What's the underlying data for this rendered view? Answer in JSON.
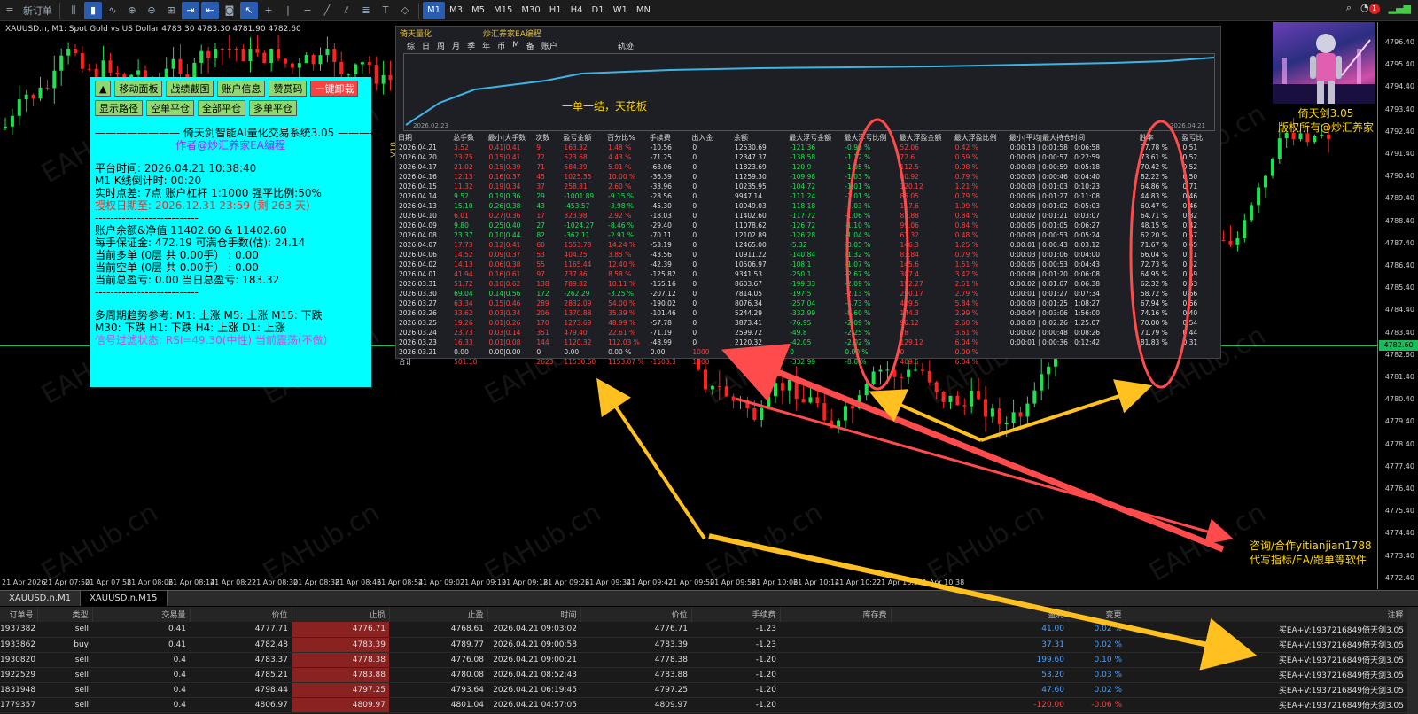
{
  "toolbar": {
    "new_order": "新订单",
    "timeframes": [
      "M1",
      "M3",
      "M5",
      "M15",
      "M30",
      "H1",
      "H4",
      "D1",
      "W1",
      "MN"
    ],
    "active_tf": "M1",
    "notif_count": "1"
  },
  "chart": {
    "title": "XAUUSD.n, M1:  Spot Gold vs US Dollar  4783.30 4783.30 4781.90 4782.60",
    "current_price": "4782.60",
    "version": "V18",
    "watermark": "EAHub.cn",
    "price_labels": [
      "4796.40",
      "4795.40",
      "4794.40",
      "4793.40",
      "4792.40",
      "4791.40",
      "4790.40",
      "4789.40",
      "4788.40",
      "4787.40",
      "4786.40",
      "4785.40",
      "4784.40",
      "4783.40",
      "4782.60",
      "4781.40",
      "4780.40",
      "4779.40",
      "4778.40",
      "4777.40",
      "4776.40",
      "4775.40",
      "4774.40",
      "4773.40",
      "4772.40"
    ],
    "time_labels": [
      "21 Apr 2026",
      "21 Apr 07:50",
      "21 Apr 07:58",
      "21 Apr 08:06",
      "21 Apr 08:14",
      "21 Apr 08:22",
      "21 Apr 08:30",
      "21 Apr 08:38",
      "21 Apr 08:46",
      "21 Apr 08:54",
      "21 Apr 09:02",
      "21 Apr 09:10",
      "21 Apr 09:18",
      "21 Apr 09:26",
      "21 Apr 09:34",
      "21 Apr 09:42",
      "21 Apr 09:50",
      "21 Apr 09:58",
      "21 Apr 10:06",
      "21 Apr 10:14",
      "21 Apr 10:22",
      "21 Apr 10:30",
      "21 Apr 10:38"
    ]
  },
  "left_panel": {
    "buttons_row1": [
      "▲",
      "移动面板",
      "战绩截图",
      "账户信息",
      "赞赏码",
      "一键卸载"
    ],
    "buttons_row2": [
      "显示路径",
      "空单平仓",
      "全部平仓",
      "多单平仓"
    ],
    "title": "———————— 倚天剑智能AI量化交易系统3.05 ————",
    "author": "作者@炒汇养家EA编程",
    "platform_time": "平台时间: 2026.04.21 10:38:40",
    "countdown": "       M1  K线倒计时:      00:20",
    "spread": "实时点差:  7点     账户杠杆 1:1000     强平比例:50%",
    "license": "授权日期至: 2026.12.31 23:59 (剩 263 天)",
    "divider": "   ---------------------------",
    "balance": "账户余额&净值 11402.60    &   11402.60",
    "margin": "每手保证金: 472.19      可满仓手数(估): 24.14",
    "buy_orders": "当前多单 (0层 共 0.00手） :  0.00",
    "sell_orders": "当前空单 (0层 共 0.00手） :  0.00",
    "total_pl": "当前总盈亏: 0.00      当日总盈亏: 183.32",
    "trend_label": "多周期趋势参考:    M1: 上涨    M5: 上涨    M15: 下跌",
    "trend_line2": "          M30: 下跌    H1: 下跌    H4: 上涨    D1: 上涨",
    "filter": "信号过滤状态: RSI=49.30(中性)      当前震荡(不做)"
  },
  "stats": {
    "header_left": "倚天量化",
    "header_mid": "炒汇养家EA编程",
    "tabs": [
      "综",
      "日",
      "周",
      "月",
      "季",
      "年",
      "币",
      "M",
      "备",
      "账户",
      "",
      "轨迹"
    ],
    "equity_text": "一单一结，天花板",
    "start_date": "2026.02.23",
    "end_date": "2026.04.21",
    "columns": [
      "日期",
      "总手数",
      "最小|大手数",
      "次数",
      "盈亏金额",
      "百分比%",
      "手续费",
      "出入金",
      "余额",
      "最大浮亏金额",
      "最大浮亏比例",
      "最大浮盈金额",
      "最大浮盈比例",
      "最小|平均|最大持仓时间",
      "",
      "胜率",
      "盈亏比"
    ],
    "rows": [
      [
        "2026.04.21",
        "3.52",
        "0.41|0.41",
        "9",
        "163.32",
        "1.48 %",
        "-10.56",
        "0",
        "12530.69",
        "-121.36",
        "-0.98 %",
        "52.06",
        "0.42 %",
        "0:00:13 | 0:01:58 | 0:06:58",
        "",
        "77.78 %",
        "0.51"
      ],
      [
        "2026.04.20",
        "23.75",
        "0.15|0.41",
        "72",
        "523.68",
        "4.43 %",
        "-71.25",
        "0",
        "12347.37",
        "-138.58",
        "-1.12 %",
        "72.6",
        "0.59 %",
        "0:00:03 | 0:00:57 | 0:22:59",
        "",
        "73.61 %",
        "0.52"
      ],
      [
        "2026.04.17",
        "21.02",
        "0.15|0.39",
        "71",
        "584.39",
        "5.01 %",
        "-63.06",
        "0",
        "11823.69",
        "-120.9",
        "-1.05 %",
        "112.5",
        "0.98 %",
        "0:00:03 | 0:00:59 | 0:05:18",
        "",
        "70.42 %",
        "0.52"
      ],
      [
        "2026.04.16",
        "12.13",
        "0.16|0.37",
        "45",
        "1025.35",
        "10.00 %",
        "-36.39",
        "0",
        "11259.30",
        "-109.98",
        "-1.03 %",
        "80.92",
        "0.79 %",
        "0:00:03 | 0:00:46 | 0:04:40",
        "",
        "82.22 %",
        "0.50"
      ],
      [
        "2026.04.15",
        "11.32",
        "0.19|0.34",
        "37",
        "258.81",
        "2.60 %",
        "-33.96",
        "0",
        "10235.95",
        "-104.72",
        "-1.01 %",
        "120.12",
        "1.21 %",
        "0:00:03 | 0:01:03 | 0:10:23",
        "",
        "64.86 %",
        "0.71"
      ],
      [
        "2026.04.14",
        "9.52",
        "0.19|0.36",
        "29",
        "-1001.89",
        "-9.15 %",
        "-28.56",
        "0",
        "9947.14",
        "-111.24",
        "-1.01 %",
        "85.05",
        "0.79 %",
        "0:00:06 | 0:01:27 | 0:11:08",
        "",
        "44.83 %",
        "0.46"
      ],
      [
        "2026.04.13",
        "15.10",
        "0.26|0.38",
        "43",
        "-453.57",
        "-3.98 %",
        "-45.30",
        "0",
        "10949.03",
        "-118.18",
        "-1.03 %",
        "117.6",
        "1.09 %",
        "0:00:03 | 0:01:02 | 0:05:03",
        "",
        "60.47 %",
        "0.46"
      ],
      [
        "2026.04.10",
        "6.01",
        "0.27|0.36",
        "17",
        "323.98",
        "2.92 %",
        "-18.03",
        "0",
        "11402.60",
        "-117.72",
        "-1.06 %",
        "82.88",
        "0.84 %",
        "0:00:02 | 0:01:21 | 0:03:07",
        "",
        "64.71 %",
        "0.82"
      ],
      [
        "2026.04.09",
        "9.80",
        "0.25|0.40",
        "27",
        "-1024.27",
        "-8.46 %",
        "-29.40",
        "0",
        "11078.62",
        "-126.72",
        "-1.10 %",
        "99.06",
        "0.84 %",
        "0:00:05 | 0:01:05 | 0:06:27",
        "",
        "48.15 %",
        "0.42"
      ],
      [
        "2026.04.08",
        "23.37",
        "0.10|0.44",
        "82",
        "-362.11",
        "-2.91 %",
        "-70.11",
        "0",
        "12102.89",
        "-126.28",
        "-1.04 %",
        "61.32",
        "0.48 %",
        "0:00:03 | 0:00:53 | 0:05:24",
        "",
        "62.20 %",
        "0.57"
      ],
      [
        "2026.04.07",
        "17.73",
        "0.12|0.41",
        "60",
        "1553.78",
        "14.24 %",
        "-53.19",
        "0",
        "12465.00",
        "-5.32",
        "-0.05 %",
        "146.3",
        "1.25 %",
        "0:00:01 | 0:00:43 | 0:03:12",
        "",
        "71.67 %",
        "0.65"
      ],
      [
        "2026.04.06",
        "14.52",
        "0.09|0.37",
        "53",
        "404.25",
        "3.85 %",
        "-43.56",
        "0",
        "10911.22",
        "-140.84",
        "-1.32 %",
        "81.84",
        "0.79 %",
        "0:00:03 | 0:01:06 | 0:04:00",
        "",
        "66.04 %",
        "0.71"
      ],
      [
        "2026.04.02",
        "14.13",
        "0.06|0.38",
        "55",
        "1165.44",
        "12.40 %",
        "-42.39",
        "0",
        "10506.97",
        "-108.1",
        "-1.07 %",
        "145.6",
        "1.51 %",
        "0:00:05 | 0:00:53 | 0:04:43",
        "",
        "72.73 %",
        "0.52"
      ],
      [
        "2026.04.01",
        "41.94",
        "0.16|0.61",
        "97",
        "737.86",
        "8.58 %",
        "-125.82",
        "0",
        "9341.53",
        "-250.1",
        "-2.67 %",
        "307.4",
        "3.42 %",
        "0:00:08 | 0:01:20 | 0:06:08",
        "",
        "64.95 %",
        "0.59"
      ],
      [
        "2026.03.31",
        "51.72",
        "0.10|0.62",
        "138",
        "789.82",
        "10.11 %",
        "-155.16",
        "0",
        "8603.67",
        "-199.33",
        "-2.09 %",
        "192.27",
        "2.51 %",
        "0:00:02 | 0:01:07 | 0:06:38",
        "",
        "62.32 %",
        "0.63"
      ],
      [
        "2026.03.30",
        "69.04",
        "0.14|0.56",
        "172",
        "-262.29",
        "-3.25 %",
        "-207.12",
        "0",
        "7814.05",
        "-197.5",
        "-2.13 %",
        "250.17",
        "2.79 %",
        "0:00:01 | 0:01:27 | 0:07:34",
        "",
        "58.72 %",
        "0.66"
      ],
      [
        "2026.03.27",
        "63.34",
        "0.15|0.46",
        "289",
        "2832.09",
        "54.00 %",
        "-190.02",
        "0",
        "8076.34",
        "-257.04",
        "-4.73 %",
        "409.5",
        "5.84 %",
        "0:00:03 | 0:01:25 | 1:08:27",
        "",
        "67.94 %",
        "0.66"
      ],
      [
        "2026.03.26",
        "33.62",
        "0.03|0.34",
        "206",
        "1370.88",
        "35.39 %",
        "-101.46",
        "0",
        "5244.29",
        "-332.99",
        "-8.60 %",
        "144.3",
        "2.99 %",
        "0:00:04 | 0:03:06 | 1:56:00",
        "",
        "74.16 %",
        "0.40"
      ],
      [
        "2026.03.25",
        "19.26",
        "0.01|0.26",
        "170",
        "1273.69",
        "48.99 %",
        "-57.78",
        "0",
        "3873.41",
        "-76.95",
        "-2.09 %",
        "96.12",
        "2.60 %",
        "0:00:03 | 0:02:26 | 1:25:07",
        "",
        "70.00 %",
        "0.54"
      ],
      [
        "2026.03.24",
        "23.73",
        "0.03|0.14",
        "351",
        "479.40",
        "22.61 %",
        "-71.19",
        "0",
        "2599.72",
        "-49.8",
        "-2.25 %",
        "78",
        "3.61 %",
        "0:00:02 | 0:00:48 | 0:08:26",
        "",
        "71.79 %",
        "0.44"
      ],
      [
        "2026.03.23",
        "16.33",
        "0.01|0.08",
        "144",
        "1120.32",
        "112.03 %",
        "-48.99",
        "0",
        "2120.32",
        "-42.05",
        "-2.02 %",
        "129.12",
        "6.04 %",
        "0:00:01 | 0:00:36 | 0:12:42",
        "",
        "81.83 %",
        "0.31"
      ],
      [
        "2026.03.21",
        "0.00",
        "0.00|0.00",
        "0",
        "0.00",
        "0.00 %",
        "0.00",
        "1000",
        "1000.00",
        "0",
        "0.00 %",
        "0",
        "0.00 %",
        "",
        "",
        "",
        ""
      ],
      [
        "合计",
        "501.10",
        "",
        "2623",
        "11530.60",
        "1153.07 %",
        "-1503.3",
        "1000",
        "",
        "-332.99",
        "-8.6 %",
        "409.5",
        "6.04 %",
        "",
        "",
        "",
        ""
      ]
    ]
  },
  "robot_caption_1": "倚天剑3.05",
  "robot_caption_2": "版权所有@炒汇养家",
  "contact_1": "咨询/合作yitianjian1788",
  "contact_2": "代写指标/EA/跟单等软件",
  "chart_tabs": [
    "XAUUSD.n,M1",
    "XAUUSD.n,M15"
  ],
  "trades": {
    "columns": [
      "订单号",
      "类型",
      "交易量",
      "价位",
      "止损",
      "止盈",
      "时间",
      "价位",
      "手续费",
      "库存费",
      "盈利",
      "变更",
      "注释"
    ],
    "rows": [
      [
        "1937382",
        "sell",
        "0.41",
        "4777.71",
        "4776.71",
        "4768.61",
        "2026.04.21 09:03:02",
        "4776.71",
        "-1.23",
        "",
        "41.00",
        "0.02 %",
        "买EA+V:1937216849倚天剑3.05"
      ],
      [
        "1933862",
        "buy",
        "0.41",
        "4782.48",
        "4783.39",
        "4789.77",
        "2026.04.21 09:00:58",
        "4783.39",
        "-1.23",
        "",
        "37.31",
        "0.02 %",
        "买EA+V:1937216849倚天剑3.05"
      ],
      [
        "1930820",
        "sell",
        "0.4",
        "4783.37",
        "4778.38",
        "4776.08",
        "2026.04.21 09:00:21",
        "4778.38",
        "-1.20",
        "",
        "199.60",
        "0.10 %",
        "买EA+V:1937216849倚天剑3.05"
      ],
      [
        "1922529",
        "sell",
        "0.4",
        "4785.21",
        "4783.88",
        "4780.08",
        "2026.04.21 08:52:43",
        "4783.88",
        "-1.20",
        "",
        "53.20",
        "0.03 %",
        "买EA+V:1937216849倚天剑3.05"
      ],
      [
        "1831948",
        "sell",
        "0.4",
        "4798.44",
        "4797.25",
        "4793.64",
        "2026.04.21 06:19:45",
        "4797.25",
        "-1.20",
        "",
        "47.60",
        "0.02 %",
        "买EA+V:1937216849倚天剑3.05"
      ],
      [
        "1779357",
        "sell",
        "0.4",
        "4806.97",
        "4809.97",
        "4801.04",
        "2026.04.21 04:57:05",
        "4809.97",
        "-1.20",
        "",
        "-120.00",
        "-0.06 %",
        "买EA+V:1937216849倚天剑3.05"
      ]
    ]
  },
  "colors": {
    "bull": "#1ee050",
    "bear": "#ff2020",
    "panel": "#00ffff",
    "accent": "#ffd700",
    "annotation_red": "#ff4b4b",
    "annotation_yellow": "#ffc020"
  }
}
